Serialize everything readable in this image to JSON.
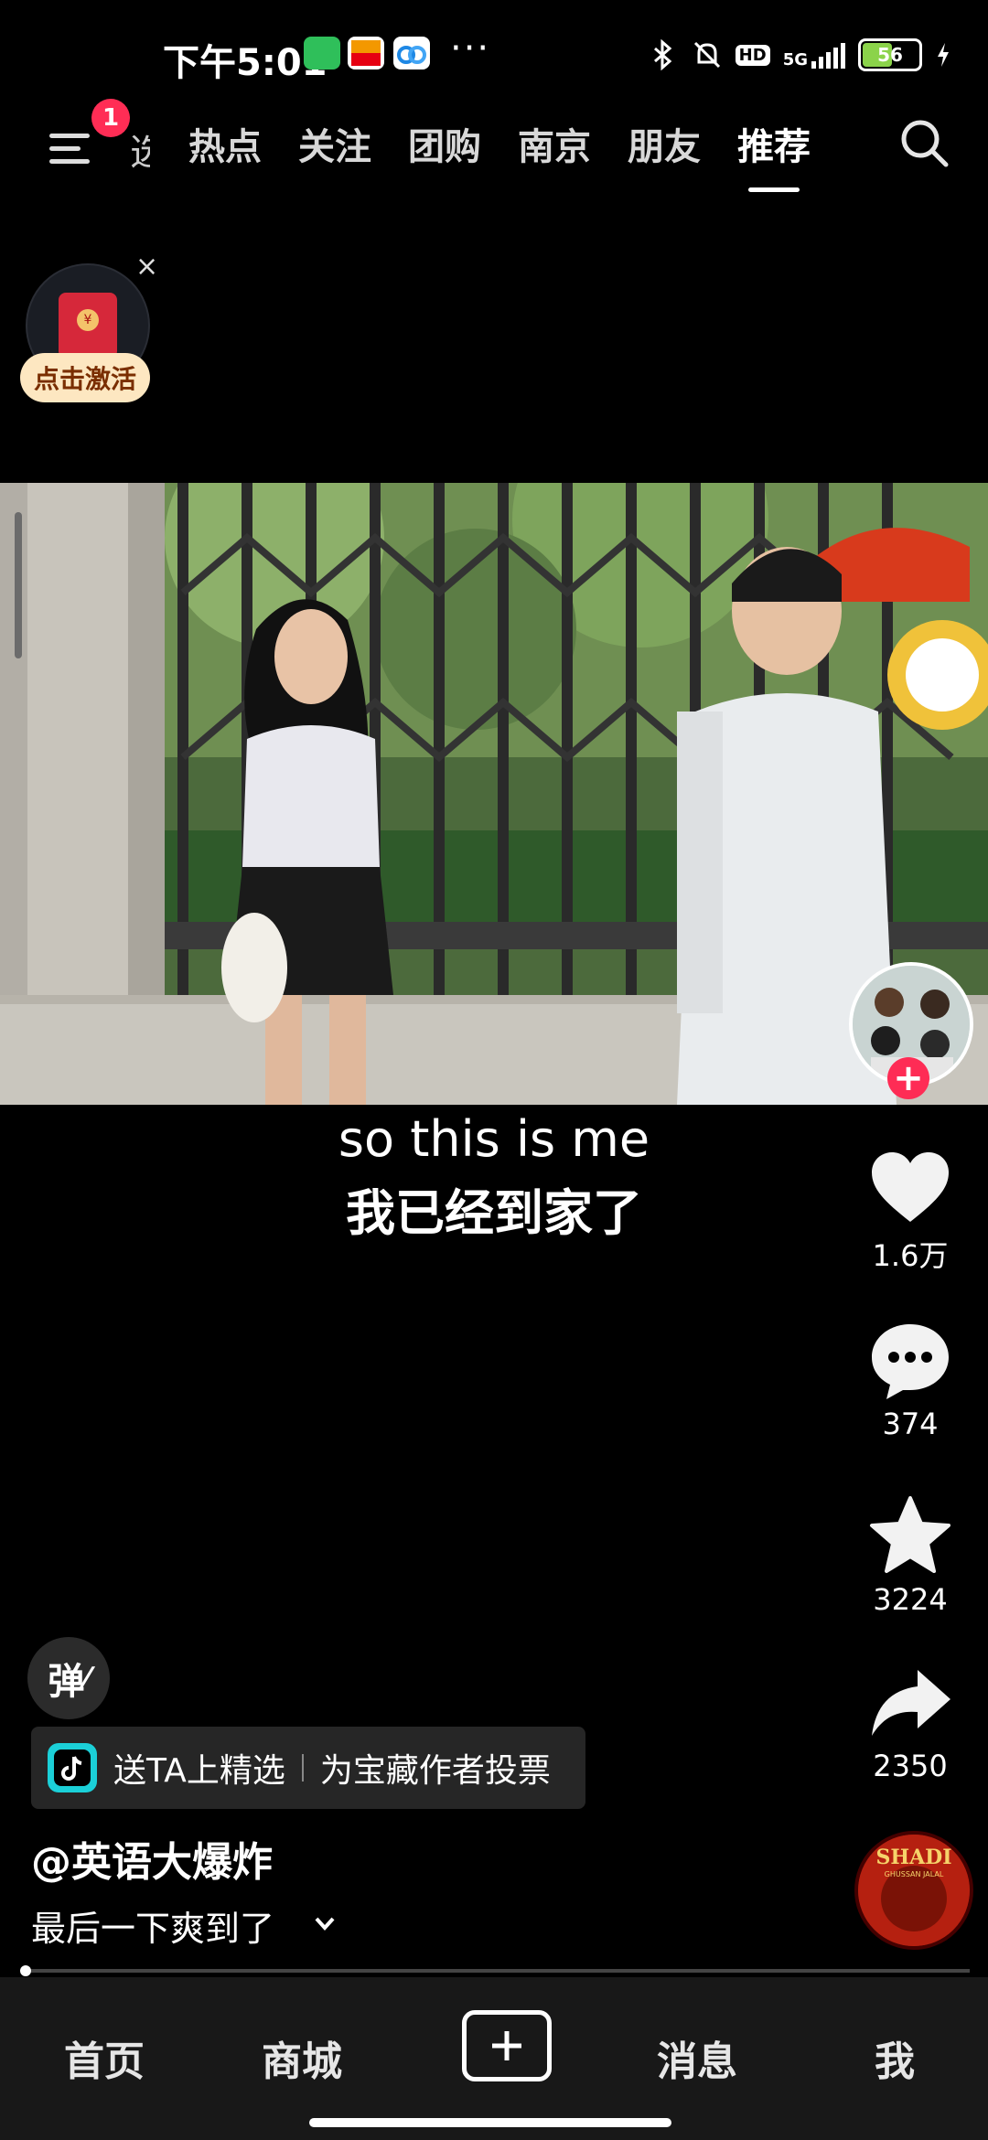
{
  "status_bar": {
    "time": "下午5:01",
    "app_icons": [
      "wechat-green-icon",
      "58-app-icon",
      "cloud-app-icon"
    ],
    "overflow": "···",
    "network": "5G",
    "hd": "HD",
    "battery_level": "56",
    "battery_fraction": 0.56
  },
  "top_nav": {
    "menu_badge": "1",
    "partial_tab": "选",
    "tabs": [
      "热点",
      "关注",
      "团购",
      "南京",
      "朋友",
      "推荐"
    ],
    "active_tab": "推荐"
  },
  "red_packet": {
    "label": "点击激活",
    "close": "×"
  },
  "video": {
    "subtitle_en": "so this is me",
    "subtitle_zh": "我已经到家了",
    "progress": 0.004
  },
  "right_rail": {
    "likes": "1.6万",
    "comments": "374",
    "favorites": "3224",
    "shares": "2350",
    "follow_symbol": "+"
  },
  "info": {
    "danmu_label": "弹",
    "promo_text_1": "送TA上精选",
    "promo_text_2": "为宝藏作者投票",
    "author": "@英语大爆炸",
    "caption": "最后一下爽到了"
  },
  "music_disc": {
    "title": "SHADI",
    "subtitle": "GHUSSAN JALAL"
  },
  "bottom_nav": {
    "items": [
      "首页",
      "商城",
      "消息",
      "我"
    ]
  }
}
